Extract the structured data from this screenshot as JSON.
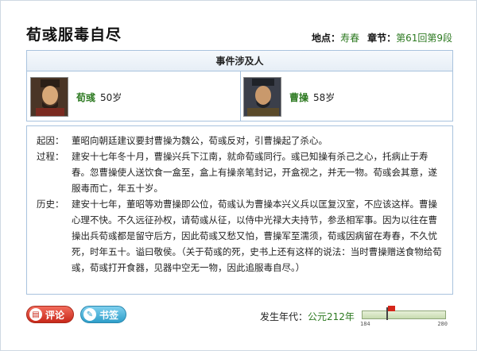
{
  "event": {
    "title": "荀彧服毒自尽",
    "location_label": "地点：",
    "location_value": "寿春",
    "chapter_label": "章节：",
    "chapter_value": "第61回第9段"
  },
  "people_section": {
    "header": "事件涉及人",
    "people": [
      {
        "name": "荀彧",
        "age": "50岁"
      },
      {
        "name": "曹操",
        "age": "58岁"
      }
    ]
  },
  "details": [
    {
      "label": "起因：",
      "text": "董昭向朝廷建议要封曹操为魏公，荀彧反对，引曹操起了杀心。"
    },
    {
      "label": "过程：",
      "text": "建安十七年冬十月，曹操兴兵下江南，就命荀彧同行。彧已知操有杀己之心，托病止于寿春。忽曹操使人送饮食一盒至，盒上有操亲笔封记，开盒视之，并无一物。荀彧会其意，遂服毒而亡，年五十岁。"
    },
    {
      "label": "历史：",
      "text": "建安十七年，董昭等劝曹操即公位，荀彧认为曹操本兴义兵以匡复汉室，不应该这样。曹操心理不快。不久远征孙权，请荀彧从征，以侍中光禄大夫持节，参丞相军事。因为以往在曹操出兵荀彧都是留守后方，因此荀彧又愁又怕，曹操军至濡须，荀彧因病留在寿春，不久忧死，时年五十。谥曰敬侯。（关于荀彧的死，史书上还有这样的说法：当时曹操赠送食物给荀彧，荀彧打开食器，见器中空无一物，因此追服毒自尽。）"
    }
  ],
  "buttons": {
    "comment": "评论",
    "bookmark": "书签"
  },
  "era": {
    "label": "发生年代：",
    "value": "公元212年",
    "timeline_min": "184",
    "timeline_max": "280",
    "timeline_current_year": 212
  }
}
